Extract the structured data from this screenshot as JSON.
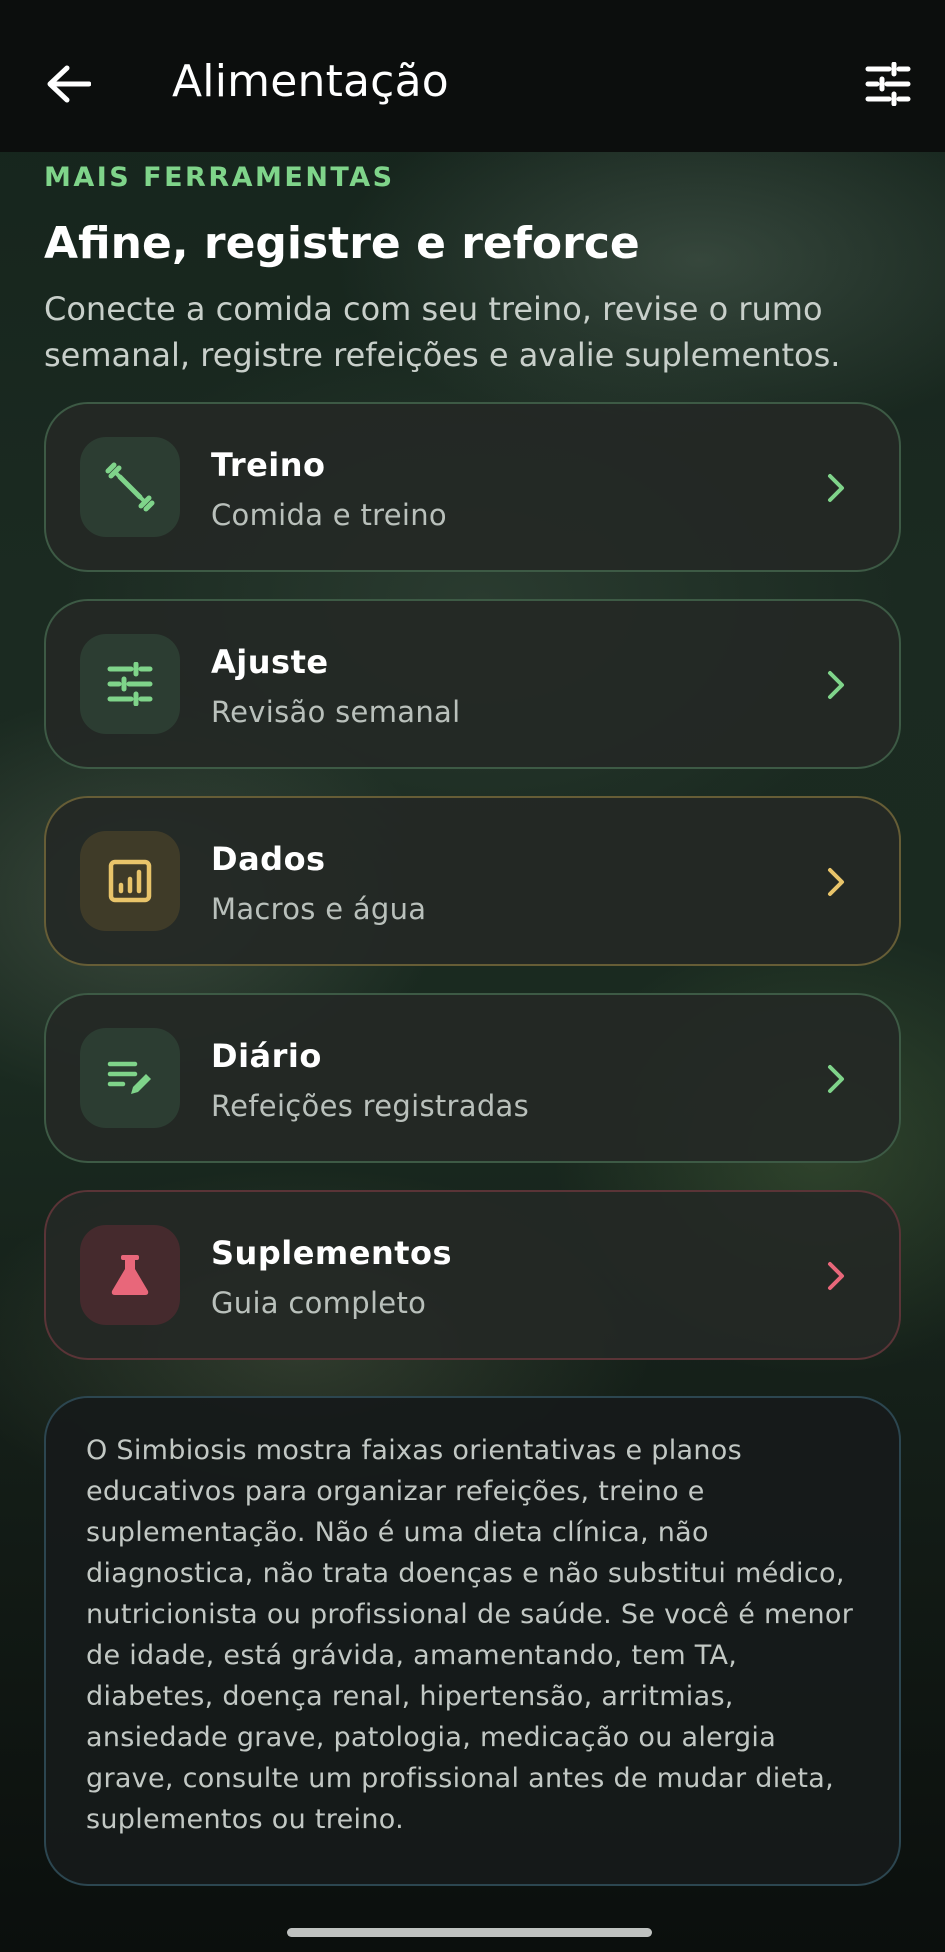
{
  "header": {
    "title": "Alimentação",
    "back_icon": "arrow-left-icon",
    "filter_icon": "sliders-icon"
  },
  "section": {
    "eyebrow": "MAIS FERRAMENTAS",
    "headline": "Afine, registre e reforce",
    "subtitle": "Conecte a comida com seu treino, revise o rumo semanal, registre refeições e avalie suplementos."
  },
  "cards": [
    {
      "title": "Treino",
      "subtitle": "Comida e treino",
      "icon": "dumbbell-icon",
      "accent": "#7fd48a"
    },
    {
      "title": "Ajuste",
      "subtitle": "Revisão semanal",
      "icon": "tune-icon",
      "accent": "#7fd48a"
    },
    {
      "title": "Dados",
      "subtitle": "Macros e água",
      "icon": "bar-chart-icon",
      "accent": "#e8c46a"
    },
    {
      "title": "Diário",
      "subtitle": "Refeições registradas",
      "icon": "edit-list-icon",
      "accent": "#7fd48a"
    },
    {
      "title": "Suplementos",
      "subtitle": "Guia completo",
      "icon": "flask-icon",
      "accent": "#e8677a"
    }
  ],
  "disclaimer": "O Simbiosis mostra faixas orientativas e planos educativos para organizar refeições, treino e suplementação. Não é uma dieta clínica, não diagnostica, não trata doenças e não substitui médico, nutricionista ou profissional de saúde. Se você é menor de idade, está grávida, amamentando, tem TA, diabetes, doença renal, hipertensão, arritmias, ansiedade grave, patologia, medicação ou alergia grave, consulte um profissional antes de mudar dieta, suplementos ou treino."
}
